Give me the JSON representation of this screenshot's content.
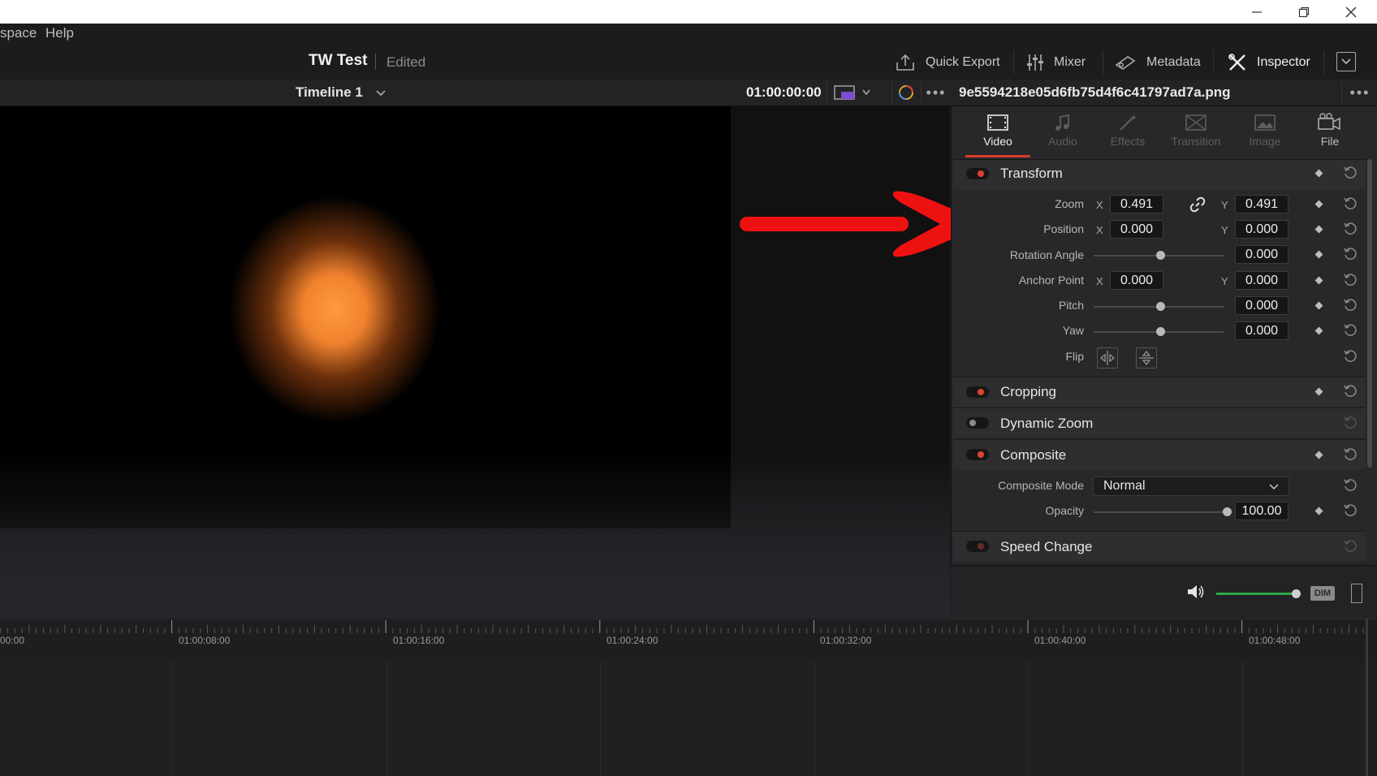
{
  "window": {
    "minimize_icon": "minimize-icon",
    "maximize_icon": "restore-icon",
    "close_icon": "close-icon"
  },
  "menu": {
    "items": [
      "space",
      "Help"
    ]
  },
  "header": {
    "project_title": "TW Test",
    "project_status": "Edited",
    "buttons": {
      "quick_export": "Quick Export",
      "mixer": "Mixer",
      "metadata": "Metadata",
      "inspector": "Inspector"
    }
  },
  "timeline_bar": {
    "timeline_name": "Timeline 1",
    "timecode": "01:00:00:00",
    "clip_filename": "9e5594218e05d6fb75d4f6c41797ad7a.png"
  },
  "inspector": {
    "tabs": [
      {
        "label": "Video",
        "icon": "film-icon",
        "active": true
      },
      {
        "label": "Audio",
        "icon": "music-note-icon",
        "active": false
      },
      {
        "label": "Effects",
        "icon": "magic-wand-icon",
        "active": false
      },
      {
        "label": "Transition",
        "icon": "transition-icon",
        "active": false
      },
      {
        "label": "Image",
        "icon": "image-icon",
        "active": false
      },
      {
        "label": "File",
        "icon": "file-icon",
        "active": false
      }
    ],
    "transform": {
      "title": "Transform",
      "zoom_label": "Zoom",
      "zoom_x": "0.491",
      "zoom_y": "0.491",
      "position_label": "Position",
      "position_x": "0.000",
      "position_y": "0.000",
      "rotation_label": "Rotation Angle",
      "rotation": "0.000",
      "anchor_label": "Anchor Point",
      "anchor_x": "0.000",
      "anchor_y": "0.000",
      "pitch_label": "Pitch",
      "pitch": "0.000",
      "yaw_label": "Yaw",
      "yaw": "0.000",
      "flip_label": "Flip",
      "axis_x": "X",
      "axis_y": "Y"
    },
    "cropping": {
      "title": "Cropping"
    },
    "dynamic_zoom": {
      "title": "Dynamic Zoom"
    },
    "composite": {
      "title": "Composite",
      "mode_label": "Composite Mode",
      "mode_value": "Normal",
      "opacity_label": "Opacity",
      "opacity": "100.00"
    },
    "speed_change": {
      "title": "Speed Change"
    }
  },
  "audio": {
    "dim_label": "DIM",
    "volume_level": 0.9
  },
  "ruler": {
    "labels": [
      "00:00",
      "01:00:08:00",
      "01:00:16:00",
      "01:00:24:00",
      "01:00:32:00",
      "01:00:40:00",
      "01:00:48:00"
    ]
  },
  "colors": {
    "accent_red": "#d83b2a",
    "arrow_red": "#ee1111",
    "volume_green": "#2fa84a"
  }
}
